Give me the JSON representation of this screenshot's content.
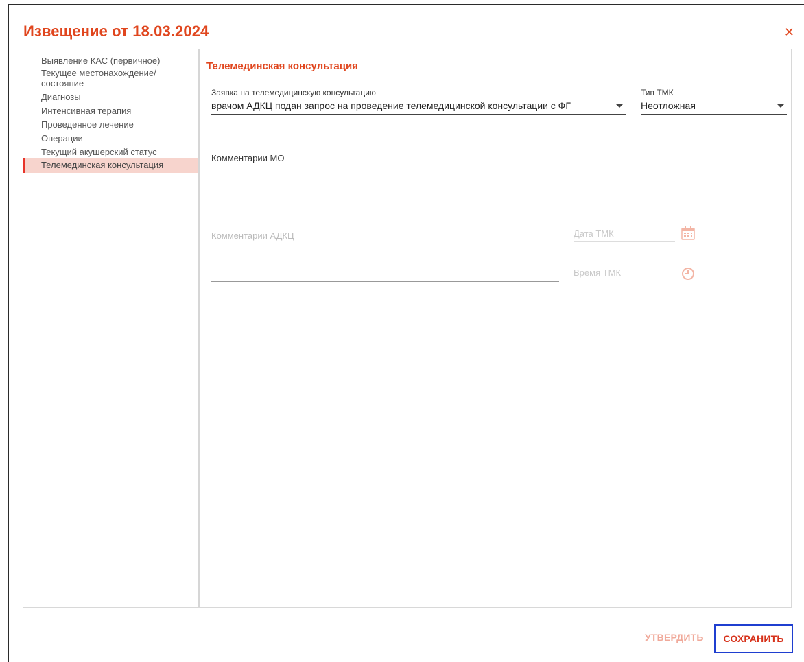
{
  "dialog": {
    "title": "Извещение от 18.03.2024",
    "close_icon": "close-icon"
  },
  "nav": {
    "items": [
      {
        "label": "Выявление КАС (первичное)"
      },
      {
        "label": "Текущее местонахождение/ состояние"
      },
      {
        "label": "Диагнозы"
      },
      {
        "label": "Интенсивная терапия"
      },
      {
        "label": "Проведенное лечение"
      },
      {
        "label": "Операции"
      },
      {
        "label": "Текущий акушерский статус"
      },
      {
        "label": "Телемединская консультация"
      }
    ],
    "active_index": 7
  },
  "section": {
    "title": "Телемединская консультация",
    "request": {
      "label": "Заявка на телемедицинскую консультацию",
      "value": "врачом АДКЦ подан запрос на проведение телемедицинской консультации с ФГ"
    },
    "tmk_type": {
      "label": "Тип ТМК",
      "value": "Неотложная"
    },
    "mo_comments": {
      "label": "Комментарии МО"
    },
    "adkc_comments": {
      "label": "Комментарии АДКЦ"
    },
    "tmk_date": {
      "placeholder": "Дата ТМК",
      "icon": "calendar-icon"
    },
    "tmk_time": {
      "placeholder": "Время ТМК",
      "icon": "clock-icon"
    }
  },
  "footer": {
    "approve_label": "УТВЕРДИТЬ",
    "save_label": "СОХРАНИТЬ"
  },
  "colors": {
    "accent": "#e0461e",
    "active_nav_bg": "#f7d4cd",
    "focus_outline": "#1f3fd0"
  }
}
